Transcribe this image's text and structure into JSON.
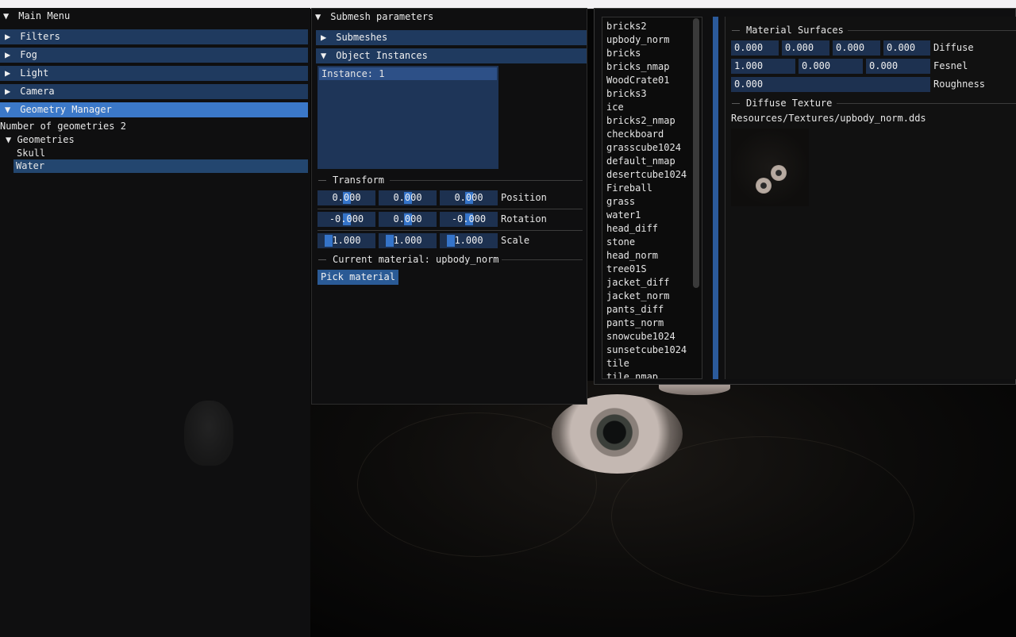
{
  "main_menu": {
    "title": "Main Menu",
    "sections": [
      "Filters",
      "Fog",
      "Light",
      "Camera",
      "Geometry Manager"
    ],
    "geometry_count_text": "Number of geometries 2",
    "geometries_label": "Geometries",
    "geometries": [
      "Skull",
      "Water"
    ],
    "selected_geometry": "Water"
  },
  "submesh": {
    "title": "Submesh parameters",
    "submeshes_label": "Submeshes",
    "object_instances_label": "Object Instances",
    "instances": [
      "Instance: 1"
    ],
    "transform_label": "Transform",
    "position": [
      "0.000",
      "0.000",
      "0.000"
    ],
    "position_label": "Position",
    "rotation": [
      "-0.000",
      "0.000",
      "-0.000"
    ],
    "rotation_label": "Rotation",
    "scale": [
      "1.000",
      "1.000",
      "1.000"
    ],
    "scale_label": "Scale",
    "current_material": "Current material: upbody_norm",
    "pick_material": "Pick material"
  },
  "textures": [
    "bricks2",
    "upbody_norm",
    "bricks",
    "bricks_nmap",
    "WoodCrate01",
    "bricks3",
    "ice",
    "bricks2_nmap",
    "checkboard",
    "grasscube1024",
    "default_nmap",
    "desertcube1024",
    "Fireball",
    "grass",
    "water1",
    "head_diff",
    "stone",
    "head_norm",
    "tree01S",
    "jacket_diff",
    "jacket_norm",
    "pants_diff",
    "pants_norm",
    "snowcube1024",
    "sunsetcube1024",
    "tile",
    "tile_nmap"
  ],
  "material": {
    "surfaces_label": "Material Surfaces",
    "diffuse": [
      "0.000",
      "0.000",
      "0.000",
      "0.000"
    ],
    "diffuse_label": "Diffuse",
    "fresnel": [
      "1.000",
      "0.000",
      "0.000"
    ],
    "fresnel_label": "Fesnel",
    "roughness": "0.000",
    "roughness_label": "Roughness",
    "diffuse_texture_label": "Diffuse Texture",
    "texture_path": "Resources/Textures/upbody_norm.dds"
  },
  "colors": {
    "header": "#1f3a5f",
    "header_active": "#3b78c8",
    "field": "#1d3150",
    "grab": "#3574c9",
    "window_bg": "#0f0f10"
  }
}
